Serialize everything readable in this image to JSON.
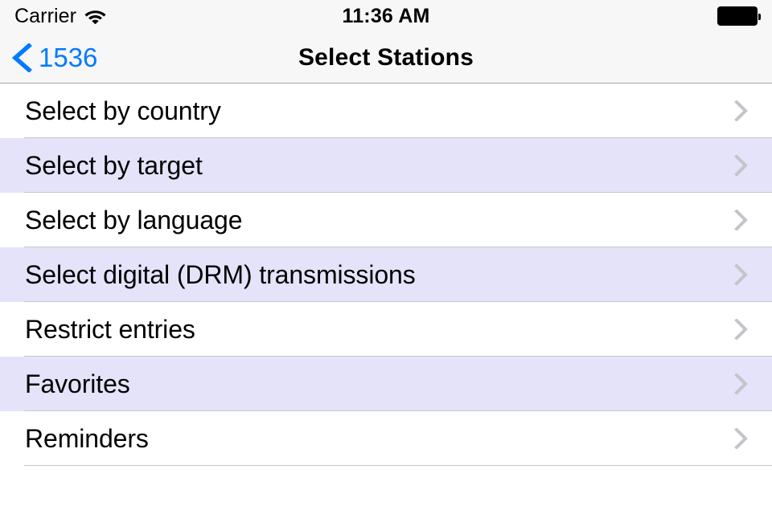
{
  "status_bar": {
    "carrier": "Carrier",
    "wifi_icon": "wifi-icon",
    "time": "11:36 AM",
    "battery_icon": "battery-full-icon"
  },
  "nav_bar": {
    "back_icon": "chevron-left-icon",
    "back_label": "1536",
    "title": "Select Stations",
    "accent_color": "#007aff",
    "background_color": "#f7f7f7"
  },
  "list": {
    "disclosure_icon": "chevron-right-icon",
    "row_alt_color": "#e4e3fa",
    "separator_color": "#c8c7cc",
    "items": [
      {
        "label": "Select by country"
      },
      {
        "label": "Select by target"
      },
      {
        "label": "Select by language"
      },
      {
        "label": "Select digital (DRM) transmissions"
      },
      {
        "label": "Restrict entries"
      },
      {
        "label": "Favorites"
      },
      {
        "label": "Reminders"
      }
    ]
  }
}
